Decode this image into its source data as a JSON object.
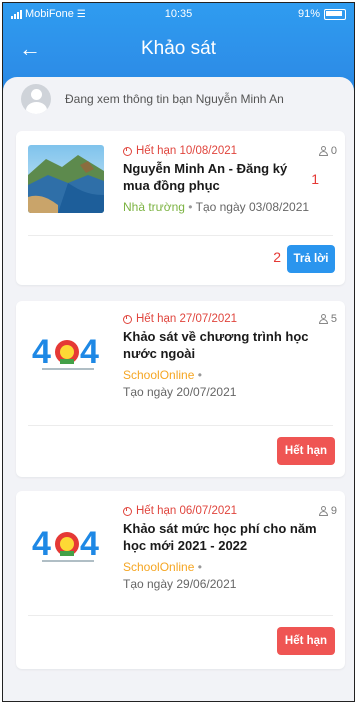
{
  "status_bar": {
    "carrier": "MobiFone",
    "time": "10:35",
    "battery": "91%"
  },
  "header": {
    "title": "Khảo sát"
  },
  "viewing": {
    "text": "Đang xem thông tin bạn Nguyễn Minh An"
  },
  "colors": {
    "header_blue": "#2d8ee8",
    "expired_red": "#e0453d",
    "button_blue": "#2a95ee",
    "button_red": "#ef5553",
    "source_green": "#7cb342",
    "source_orange": "#f5a623"
  },
  "surveys": [
    {
      "expire": "Hết hạn 10/08/2021",
      "count": "0",
      "title": "Nguyễn Minh An - Đăng ký mua đồng phục",
      "source": "Nhà trường",
      "created": "Tạo ngày 03/08/2021",
      "button": "Trả lời",
      "thumbnail": "landscape-photo"
    },
    {
      "expire": "Hết hạn 27/07/2021",
      "count": "5",
      "title": "Khảo sát về chương trình học nước ngoài",
      "source": "SchoolOnline",
      "created": "Tạo ngày 20/07/2021",
      "button": "Hết hạn",
      "thumbnail": "404-logo"
    },
    {
      "expire": "Hết hạn 06/07/2021",
      "count": "9",
      "title": "Khảo sát mức học phí cho năm học mới 2021 - 2022",
      "source": "SchoolOnline",
      "created": "Tạo ngày 29/06/2021",
      "button": "Hết hạn",
      "thumbnail": "404-logo"
    }
  ],
  "annotations": {
    "one": "1",
    "two": "2"
  }
}
